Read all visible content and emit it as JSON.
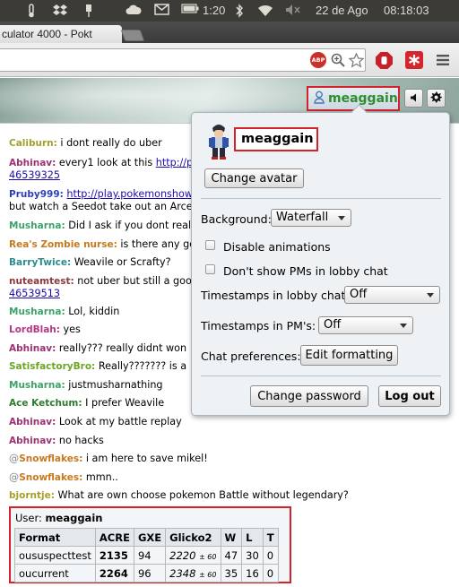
{
  "os_panel": {
    "time_display": "1:20",
    "date": "22 de Ago",
    "clock": "08:18:03"
  },
  "browser": {
    "tab_title": "culator 4000 - Pokt",
    "adblock_label": "ABP"
  },
  "header": {
    "username": "meaggain"
  },
  "chat": [
    {
      "name": "Caliburn:",
      "color": "#a1a12b",
      "text": "i dont really do uber"
    },
    {
      "name": "Abhinav:",
      "color": "#9c3272",
      "text": "every1 look at this ",
      "link": "http://po"
    },
    {
      "link_only": "46539325"
    },
    {
      "name": "Pruby999:",
      "color": "#2d3fb6",
      "text": "",
      "link": "http://play.pokemonshow"
    },
    {
      "plain": "but watch a Seedot take out an Arceu"
    },
    {
      "name": "Musharna:",
      "color": "#3aa36a",
      "text": "Did I ask if you dont really"
    },
    {
      "name": "Rea's Zombie nurse:",
      "color": "#c47a1e",
      "text": "is there any go"
    },
    {
      "name": "BarryTwice:",
      "color": "#2c8c8c",
      "text": "Weavile or Scrafty?"
    },
    {
      "name": "nuteamtest:",
      "color": "#8c3a3a",
      "text": "not uber but still a good"
    },
    {
      "link_only": "46539513"
    },
    {
      "name": "Musharna:",
      "color": "#3aa36a",
      "text": "Lol, kiddin"
    },
    {
      "name": "LordBlah:",
      "color": "#b5368a",
      "text": "yes"
    },
    {
      "name": "Abhinav:",
      "color": "#9c3272",
      "text": "really??? really didnt won"
    },
    {
      "name": "SatisfactoryBro:",
      "color": "#6ba628",
      "text": "Really??????? is a"
    },
    {
      "name": "Musharna:",
      "color": "#3aa36a",
      "text": "justmusharnathing"
    },
    {
      "name": "Ace Ketchum:",
      "color": "#2e7d2e",
      "text": "I prefer Weavile"
    },
    {
      "name": "Abhinav:",
      "color": "#9c3272",
      "text": "Look at my battle replay"
    },
    {
      "name": "Abhinav:",
      "color": "#9c3272",
      "text": "no hacks"
    },
    {
      "name": "Snowflakes:",
      "at": "@",
      "color": "#c9781f",
      "text": "i am here to save mikel!"
    },
    {
      "name": "Snowflakes:",
      "at": "@",
      "color": "#c9781f",
      "text": "mmn.."
    },
    {
      "name": "bjorntje:",
      "color": "#a6a02a",
      "text": "What are own choose pokemon Battle without legendary?"
    }
  ],
  "popup": {
    "username": "meaggain",
    "change_avatar": "Change avatar",
    "background_label": "Background:",
    "background_value": "Waterfall",
    "disable_animations": "Disable animations",
    "no_pms": "Don't show PMs in lobby chat",
    "timestamps_lobby_label": "Timestamps in lobby chat:",
    "timestamps_lobby_value": "Off",
    "timestamps_pm_label": "Timestamps in PM's:",
    "timestamps_pm_value": "Off",
    "chat_prefs_label": "Chat preferences:",
    "edit_formatting": "Edit formatting",
    "change_password": "Change password",
    "log_out": "Log out"
  },
  "stats": {
    "user_label": "User:",
    "user_name": "meaggain",
    "headers": [
      "Format",
      "ACRE",
      "GXE",
      "Glicko2",
      "W",
      "L",
      "T"
    ],
    "rows": [
      {
        "format": "oususpecttest",
        "acre": "2135",
        "gxe": "94",
        "glicko": "2220",
        "pm": "± 60",
        "w": "47",
        "l": "30",
        "t": "0"
      },
      {
        "format": "oucurrent",
        "acre": "2264",
        "gxe": "96",
        "glicko": "2348",
        "pm": "± 60",
        "w": "35",
        "l": "16",
        "t": "0"
      }
    ]
  },
  "colors": {
    "highlight_border": "#d2232a",
    "username_green": "#2f8c2f",
    "os_panel": "#3c3b37"
  }
}
